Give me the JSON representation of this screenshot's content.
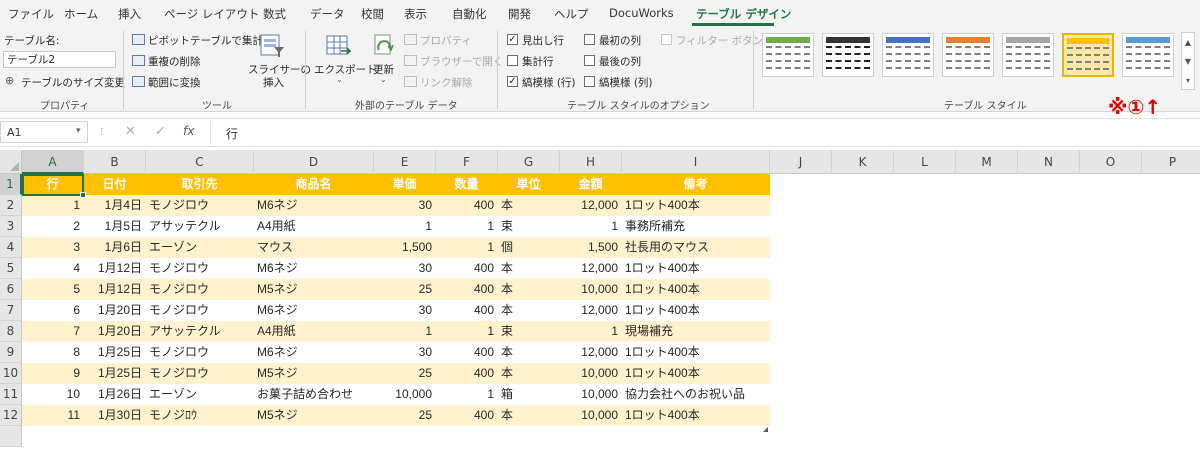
{
  "menu": [
    "ファイル",
    "ホーム",
    "挿入",
    "ページ レイアウト",
    "数式",
    "データ",
    "校閲",
    "表示",
    "自動化",
    "開発",
    "ヘルプ",
    "DocuWorks",
    "テーブル デザイン"
  ],
  "ribbon": {
    "properties": {
      "name_label": "テーブル名:",
      "name_value": "テーブル2",
      "resize": "テーブルのサイズ変更",
      "group": "プロパティ"
    },
    "tools": {
      "pivot": "ピボットテーブルで集計",
      "remove_dup": "重複の削除",
      "convert": "範囲に変換",
      "slicer_1": "スライサーの",
      "slicer_2": "挿入",
      "group": "ツール"
    },
    "external": {
      "export": "エクスポート",
      "refresh": "更新",
      "properties": "プロパティ",
      "browser": "ブラウザーで開く",
      "unlink": "リンク解除",
      "group": "外部のテーブル データ"
    },
    "style_options": {
      "header_row": "見出し行",
      "total_row": "集計行",
      "banded_rows": "縞模様 (行)",
      "first_col": "最初の列",
      "last_col": "最後の列",
      "banded_cols": "縞模様 (列)",
      "filter_btn": "フィルター ボタン",
      "group": "テーブル スタイルのオプション"
    },
    "styles": {
      "group": "テーブル スタイル",
      "swatches": [
        "#70ad47",
        "#333333",
        "#4472c4",
        "#ed7d31",
        "#a5a5a5",
        "#ffc000",
        "#5b9bd5"
      ]
    }
  },
  "annotation": "※①↑",
  "formula": {
    "name_box": "A1",
    "value": "行"
  },
  "columns": [
    "A",
    "B",
    "C",
    "D",
    "E",
    "F",
    "G",
    "H",
    "I",
    "J",
    "K",
    "L",
    "M",
    "N",
    "O",
    "P"
  ],
  "rows": [
    "1",
    "2",
    "3",
    "4",
    "5",
    "6",
    "7",
    "8",
    "9",
    "10",
    "11",
    "12",
    ""
  ],
  "table": {
    "headers": [
      "行",
      "日付",
      "取引先",
      "商品名",
      "単価",
      "数量",
      "単位",
      "金額",
      "備考"
    ],
    "rows": [
      [
        "1",
        "1月4日",
        "モノジロウ",
        "M6ネジ",
        "30",
        "400",
        "本",
        "12,000",
        "1ロット400本"
      ],
      [
        "2",
        "1月5日",
        "アサッテクル",
        "A4用紙",
        "1",
        "1",
        "束",
        "1",
        "事務所補充"
      ],
      [
        "3",
        "1月6日",
        "エーゾン",
        "マウス",
        "1,500",
        "1",
        "個",
        "1,500",
        "社長用のマウス"
      ],
      [
        "4",
        "1月12日",
        "モノジロウ",
        "M6ネジ",
        "30",
        "400",
        "本",
        "12,000",
        "1ロット400本"
      ],
      [
        "5",
        "1月12日",
        "モノジロウ",
        "M5ネジ",
        "25",
        "400",
        "本",
        "10,000",
        "1ロット400本"
      ],
      [
        "6",
        "1月20日",
        "モノジロウ",
        "M6ネジ",
        "30",
        "400",
        "本",
        "12,000",
        "1ロット400本"
      ],
      [
        "7",
        "1月20日",
        "アサッテクル",
        "A4用紙",
        "1",
        "1",
        "束",
        "1",
        "現場補充"
      ],
      [
        "8",
        "1月25日",
        "モノジロウ",
        "M6ネジ",
        "30",
        "400",
        "本",
        "12,000",
        "1ロット400本"
      ],
      [
        "9",
        "1月25日",
        "モノジロウ",
        "M5ネジ",
        "25",
        "400",
        "本",
        "10,000",
        "1ロット400本"
      ],
      [
        "10",
        "1月26日",
        "エーゾン",
        "お菓子詰め合わせ",
        "10,000",
        "1",
        "箱",
        "10,000",
        "協力会社へのお祝い品"
      ],
      [
        "11",
        "1月30日",
        "モノジﾛｳ",
        "M5ネジ",
        "25",
        "400",
        "本",
        "10,000",
        "1ロット400本"
      ]
    ]
  }
}
